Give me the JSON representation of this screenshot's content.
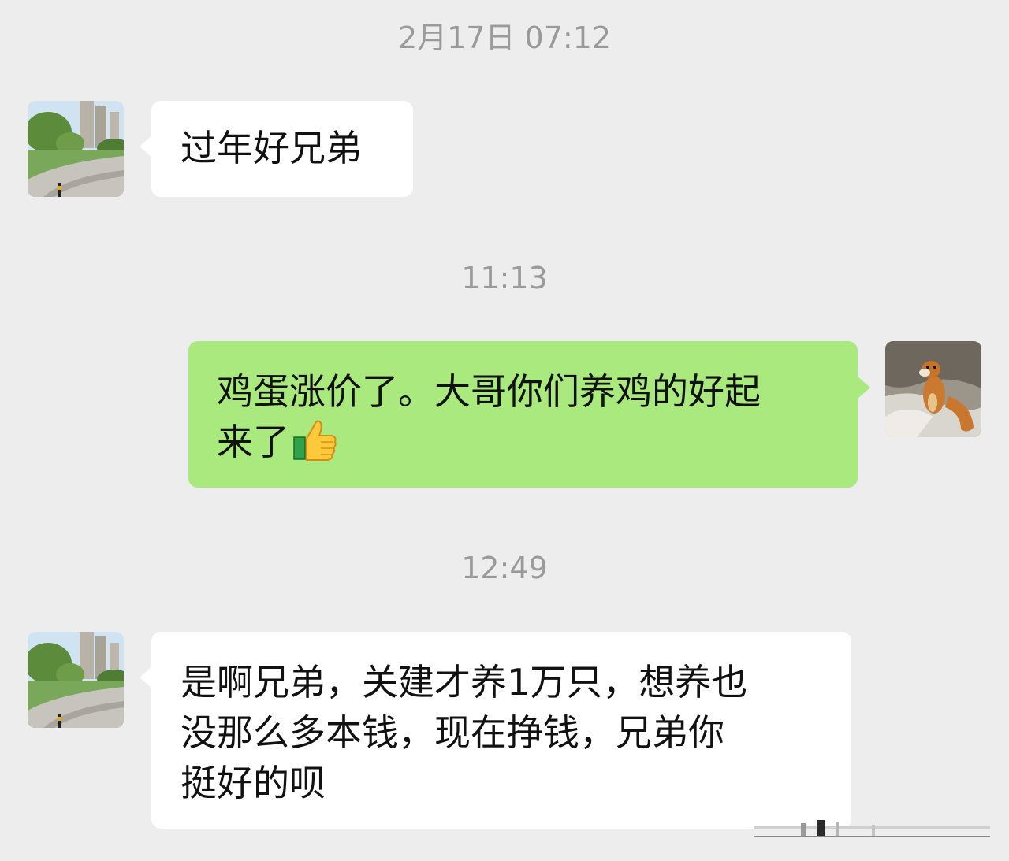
{
  "chat": {
    "messages": [
      {
        "kind": "time",
        "text": "2月17日 07:12"
      },
      {
        "kind": "in",
        "sender_avatar": "park-avatar",
        "text": "过年好兄弟"
      },
      {
        "kind": "time",
        "text": "11:13"
      },
      {
        "kind": "out",
        "sender_avatar": "weasel-avatar",
        "text": "鸡蛋涨价了。大哥你们养鸡的好起\n来了",
        "emoji": "thumbs-up-icon"
      },
      {
        "kind": "time",
        "text": "12:49"
      },
      {
        "kind": "in",
        "sender_avatar": "park-avatar",
        "text": "是啊兄弟，关建才养1万只，想养也\n没那么多本钱，现在挣钱，兄弟你\n挺好的呗"
      }
    ]
  },
  "colors": {
    "background": "#ededed",
    "incoming_bubble": "#ffffff",
    "outgoing_bubble": "#a9e97d",
    "timestamp_text": "#9a9a9a"
  }
}
